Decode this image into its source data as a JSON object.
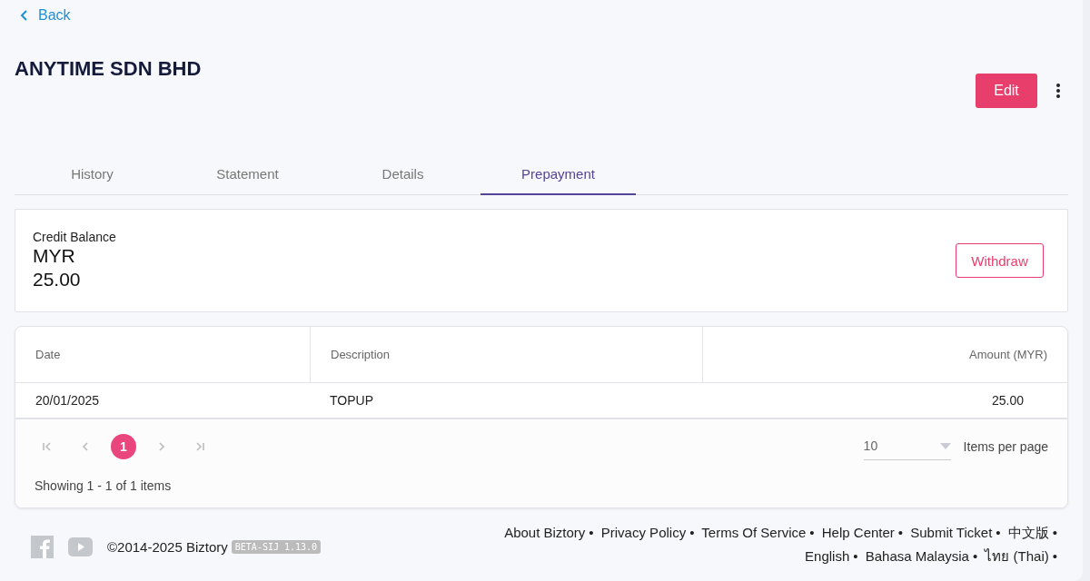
{
  "back": {
    "label": "Back"
  },
  "header": {
    "title": "ANYTIME SDN BHD",
    "edit_button": "Edit"
  },
  "tabs": [
    {
      "label": "History",
      "selected": false
    },
    {
      "label": "Statement",
      "selected": false
    },
    {
      "label": "Details",
      "selected": false
    },
    {
      "label": "Prepayment",
      "selected": true
    }
  ],
  "balance": {
    "label": "Credit Balance",
    "currency": "MYR",
    "amount": "25.00",
    "button": "Withdraw"
  },
  "table": {
    "columns": [
      "Date",
      "Description",
      "Amount (MYR)"
    ],
    "rows": [
      [
        "20/01/2025",
        "TOPUP",
        "25.00"
      ]
    ]
  },
  "pagination": {
    "pages": [
      {
        "label": "1",
        "selected": true
      }
    ],
    "page_size": "10",
    "page_size_label": "Items per page",
    "summary": "Showing 1 - 1 of 1 items"
  },
  "footer": {
    "copyright": "©2014-2025 Biztory",
    "version": "BETA-SIJ 1.13.0",
    "separator": "•",
    "links": [
      "About Biztory",
      "Privacy Policy",
      "Terms Of Service",
      "Help Center",
      "Submit Ticket",
      "中文版",
      "English",
      "Bahasa Malaysia",
      "ไทย (Thai)"
    ]
  }
}
